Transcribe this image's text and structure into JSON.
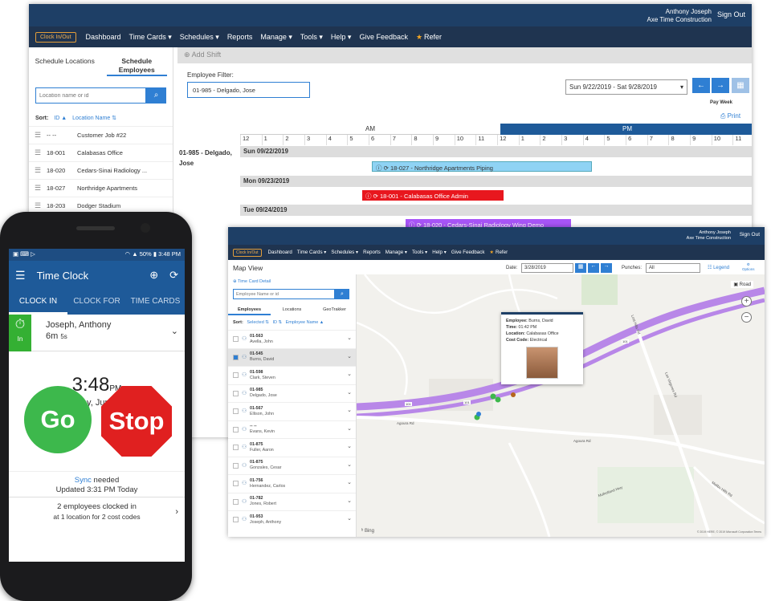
{
  "schedule": {
    "user_name": "Anthony Joseph",
    "company": "Axe Time Construction",
    "sign_out": "Sign Out",
    "clock_btn": "Clock In/Out",
    "nav": [
      "Dashboard",
      "Time Cards ▾",
      "Schedules ▾",
      "Reports",
      "Manage ▾",
      "Tools ▾",
      "Help ▾",
      "Give Feedback",
      "Refer"
    ],
    "tab_locations": "Schedule Locations",
    "tab_employees": "Schedule Employees",
    "search_placeholder": "Location name or id",
    "sort_label": "Sort:",
    "sort_id": "ID ▲",
    "sort_name": "Location Name ⇅",
    "locations": [
      {
        "id": "-- --",
        "name": "Customer Job #22"
      },
      {
        "id": "18-001",
        "name": "Calabasas Office"
      },
      {
        "id": "18-020",
        "name": "Cedars-Sinai Radiology ..."
      },
      {
        "id": "18-027",
        "name": "Northridge Apartments"
      },
      {
        "id": "18-203",
        "name": "Dodger Stadium"
      }
    ],
    "add_shift": "Add Shift",
    "employee_filter_label": "Employee Filter:",
    "employee_filter_value": "01-985 - Delgado, Jose",
    "date_range": "Sun 9/22/2019 - Sat 9/28/2019",
    "pay_week": "Pay Week",
    "print": "Print",
    "am": "AM",
    "pm": "PM",
    "hours": [
      "12",
      "1",
      "2",
      "3",
      "4",
      "5",
      "6",
      "7",
      "8",
      "9",
      "10",
      "11",
      "12",
      "1",
      "2",
      "3",
      "4",
      "5",
      "6",
      "7",
      "8",
      "9",
      "10",
      "11"
    ],
    "employee": "01-985 - Delgado, Jose",
    "days": [
      "Sun 09/22/2019",
      "Mon 09/23/2019",
      "Tue 09/24/2019"
    ],
    "shifts": [
      {
        "label": "18-027 - Northridge Apartments Piping",
        "color": "#8fd3f4"
      },
      {
        "label": "18-001 - Calabasas Office Admin",
        "color": "#e8171e"
      },
      {
        "label": "18-020 - Cedars-Sinai Radiology Wing Demo",
        "color": "#a855f7"
      }
    ]
  },
  "mapwin": {
    "user_name": "Anthony Joseph",
    "company": "Axe Time Construction",
    "sign_out": "Sign Out",
    "clock_btn": "Clock In/Out",
    "nav": [
      "Dashboard",
      "Time Cards ▾",
      "Schedules ▾",
      "Reports",
      "Manage ▾",
      "Tools ▾",
      "Help ▾",
      "Give Feedback",
      "Refer"
    ],
    "title": "Map View",
    "date_label": "Date:",
    "date_value": "3/28/2019",
    "punches_label": "Punches:",
    "punches_value": "All",
    "legend": "Legend",
    "options": "Options",
    "time_card_detail": "Time Card Detail",
    "search_placeholder": "Employee Name or id",
    "tabs": [
      "Employees",
      "Locations",
      "GeoTrakker"
    ],
    "sort_label": "Sort:",
    "sort_selected": "Selected ⇅",
    "sort_id": "ID ⇅",
    "sort_name": "Employee Name ▲",
    "employees": [
      {
        "id": "01-563",
        "name": "Avella, John"
      },
      {
        "id": "01-545",
        "name": "Burns, David"
      },
      {
        "id": "01-598",
        "name": "Clark, Steven"
      },
      {
        "id": "01-985",
        "name": "Delgado, Jose"
      },
      {
        "id": "01-567",
        "name": "Ellison, John"
      },
      {
        "id": "-- --",
        "name": "Evans, Kevin"
      },
      {
        "id": "01-875",
        "name": "Fuller, Aaron"
      },
      {
        "id": "01-875",
        "name": "Gonzales, Cesar"
      },
      {
        "id": "01-756",
        "name": "Hernandez, Carlos"
      },
      {
        "id": "01-782",
        "name": "Jones, Robert"
      },
      {
        "id": "01-953",
        "name": "Joseph, Anthony"
      }
    ],
    "road": "Road",
    "popup": {
      "employee_label": "Employee:",
      "employee": "Burns, David",
      "time_label": "Time:",
      "time": "01:42 PM",
      "location_label": "Location:",
      "location": "Calabasas Office",
      "cost_label": "Cost Code:",
      "cost": "Electrical"
    },
    "streets": [
      "Agoura Rd",
      "Agoura Rd",
      "101",
      "101",
      "101",
      "Lost Hills Rd",
      "Las Virgenes Rd",
      "Malibu Hills Rd",
      "Mulholland Hwy"
    ],
    "bing": "Bing",
    "copyright": "© 2019 HERE, © 2019 Microsoft Corporation  Terms"
  },
  "phone": {
    "battery": "50%",
    "time": "3:48 PM",
    "title": "Time Clock",
    "tabs": [
      "CLOCK IN",
      "CLOCK FOR",
      "TIME CARDS"
    ],
    "in": "In",
    "employee": "Joseph, Anthony",
    "duration": "6m",
    "duration_sec": "5s",
    "clock": "3:48",
    "ampm": "PM",
    "date": "Friday, June 14",
    "go": "Go",
    "stop": "Stop",
    "sync_link": "Sync",
    "sync_text": " needed",
    "updated": "Updated 3:31 PM Today",
    "clocked_main": "2 employees clocked in",
    "clocked_sub": "at 1 location for 2 cost codes"
  }
}
